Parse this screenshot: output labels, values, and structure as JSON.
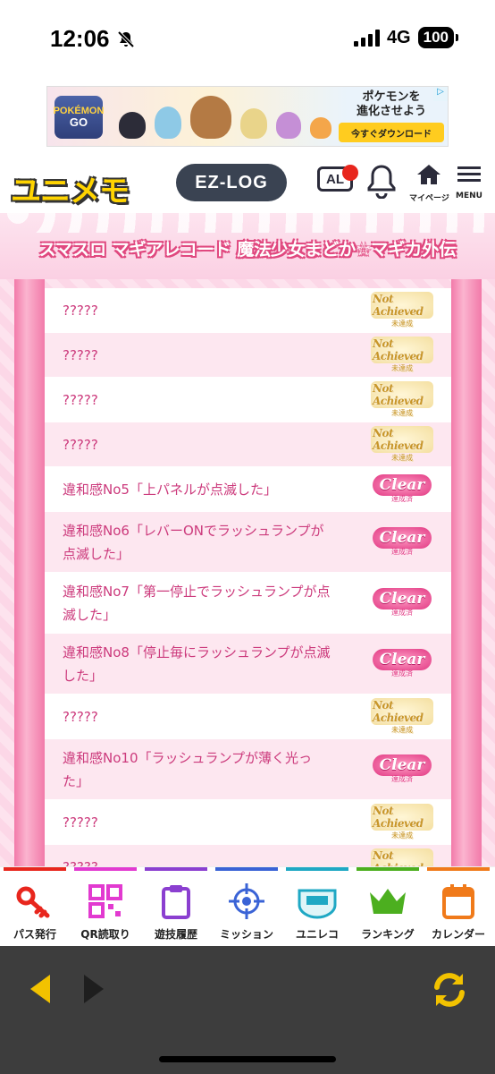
{
  "status": {
    "time": "12:06",
    "network": "4G",
    "battery": "100"
  },
  "ad": {
    "brand_line1": "POKÉMON",
    "brand_line2": "GO",
    "copy_line1": "ポケモンを",
    "copy_line2": "進化させよう",
    "cta": "今すぐダウンロード"
  },
  "header": {
    "logo": "ユニメモ",
    "ezlog": "EZ-LOG",
    "al_icon": "AL",
    "mypage_label": "マイページ",
    "menu_label": "MENU"
  },
  "page_title": "スマスロ マギアレコード 魔法少女まどか☆マギカ外伝",
  "badges": {
    "not_achieved": {
      "main": "Not Achieved",
      "sub": "未達成"
    },
    "clear": {
      "main": "Clear",
      "sub": "達成済"
    }
  },
  "rows": [
    {
      "text": "?????",
      "status": "not_achieved"
    },
    {
      "text": "?????",
      "status": "not_achieved"
    },
    {
      "text": "?????",
      "status": "not_achieved"
    },
    {
      "text": "?????",
      "status": "not_achieved"
    },
    {
      "text": "違和感No5「上パネルが点滅した」",
      "status": "clear"
    },
    {
      "text": "違和感No6「レバーONでラッシュランプが点滅した」",
      "status": "clear"
    },
    {
      "text": "違和感No7「第一停止でラッシュランプが点滅した」",
      "status": "clear"
    },
    {
      "text": "違和感No8「停止毎にラッシュランプが点滅した」",
      "status": "clear"
    },
    {
      "text": "?????",
      "status": "not_achieved"
    },
    {
      "text": "違和感No10「ラッシュランプが薄く光った」",
      "status": "clear"
    },
    {
      "text": "?????",
      "status": "not_achieved"
    },
    {
      "text": "?????",
      "status": "not_achieved"
    }
  ],
  "bottom_nav": [
    {
      "label": "パス発行",
      "icon": "key-icon",
      "color": "#e8261d"
    },
    {
      "label": "QR読取り",
      "icon": "qr-code-icon",
      "color": "#e23ad0"
    },
    {
      "label": "遊技履歴",
      "icon": "clipboard-icon",
      "color": "#8b3fd0"
    },
    {
      "label": "ミッション",
      "icon": "target-icon",
      "color": "#3a63d6"
    },
    {
      "label": "ユニレコ",
      "icon": "unireco-icon",
      "color": "#1fa8c4"
    },
    {
      "label": "ランキング",
      "icon": "crown-icon",
      "color": "#4caf1f"
    },
    {
      "label": "カレンダー",
      "icon": "calendar-icon",
      "color": "#f07a1a"
    }
  ],
  "colors": {
    "accent_pink": "#e23a84",
    "row_text": "#cc3a7c",
    "browser_bar": "#3d3d3d",
    "browser_icon": "#f2c200"
  }
}
